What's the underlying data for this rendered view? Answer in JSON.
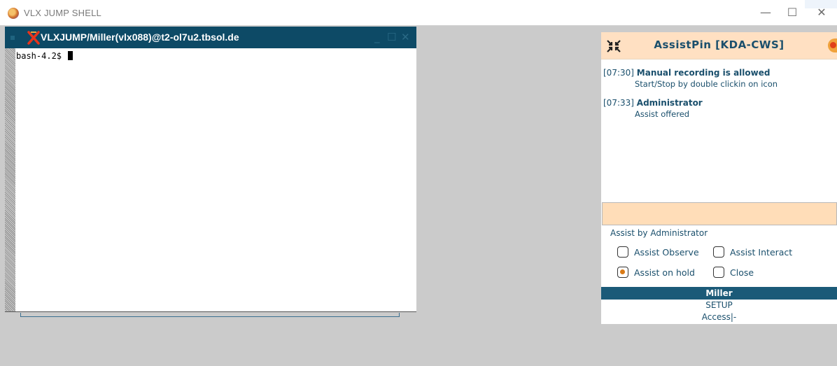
{
  "window": {
    "title": "VLX JUMP SHELL",
    "minimize": "—",
    "maximize": "☐",
    "close": "✕"
  },
  "terminal": {
    "title": "VLXJUMP/Miller(vlx088)@t2-ol7u2.tbsol.de",
    "prompt": "bash-4.2$ ",
    "minimize": "_",
    "maximize": "☐",
    "close": "✕"
  },
  "assistpin": {
    "title": "AssistPin [KDA-CWS]",
    "log": [
      {
        "time": "[07:30]",
        "head": "Manual recording is allowed",
        "sub": "Start/Stop by double clickin on icon"
      },
      {
        "time": "[07:33]",
        "head": "Administrator",
        "sub": "Assist offered"
      }
    ],
    "options_label": "Assist by Administrator",
    "options": [
      {
        "label": "Assist Observe",
        "selected": false
      },
      {
        "label": "Assist Interact",
        "selected": false
      },
      {
        "label": "Assist on hold",
        "selected": true
      },
      {
        "label": "Close",
        "selected": false
      }
    ],
    "user": "Miller",
    "setup": "SETUP",
    "access": "Access|-"
  },
  "colors": {
    "terminal_titlebar": "#0d4a66",
    "panel_header": "#ffe0c2",
    "panel_text": "#1a4f6c",
    "desktop": "#cbcbcb"
  }
}
